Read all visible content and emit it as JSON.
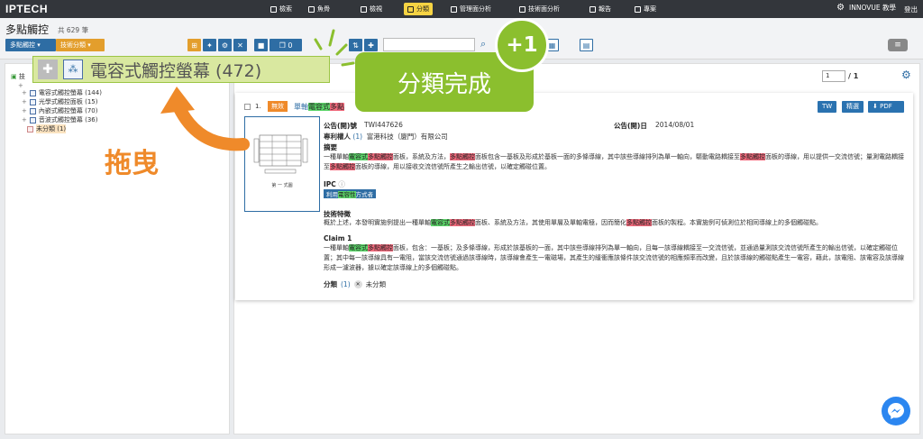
{
  "app": {
    "logo": "IPTECH",
    "logo_icon": "grid-logo-icon"
  },
  "nav": [
    {
      "label": "檢索",
      "icon": "search-icon"
    },
    {
      "label": "魚骨",
      "icon": "fishbone-icon"
    },
    {
      "label": "檢視",
      "icon": "view-icon"
    },
    {
      "label": "分類",
      "icon": "tag-icon",
      "active": true
    },
    {
      "label": "管理面分析",
      "icon": "chart-icon"
    },
    {
      "label": "技術面分析",
      "icon": "chart-icon"
    },
    {
      "label": "報告",
      "icon": "report-icon"
    },
    {
      "label": "專案",
      "icon": "project-icon"
    }
  ],
  "user": {
    "name": "INNOVUE 教學",
    "logout": "登出"
  },
  "header": {
    "title": "多點觸控",
    "count": "共 629 筆",
    "btn1": "多點觸控",
    "btn2": "技術分類",
    "toggle_count": "0"
  },
  "pager": {
    "current": "1",
    "total": "/ 1"
  },
  "tree": {
    "root": "技",
    "items": [
      {
        "label": "電容式觸控螢幕 (144)"
      },
      {
        "label": "光學式觸控面板 (15)"
      },
      {
        "label": "內嵌式觸控螢幕 (70)"
      },
      {
        "label": "音波式觸控螢幕 (36)"
      },
      {
        "label": "未分類 (1)"
      }
    ]
  },
  "card": {
    "index": "1.",
    "badge": "無效",
    "title_pre": "單軸",
    "title_green": "電容式",
    "title_red": "多點",
    "buttons": {
      "tw": "TW",
      "brief": "精選",
      "pdf": "PDF"
    },
    "pub_no_label": "公告(開)號",
    "pub_no": "TWI447626",
    "pub_date_label": "公告(開)日",
    "pub_date": "2014/08/01",
    "assignee_label": "專利權人",
    "assignee_count": "(1)",
    "assignee": "富港科技（廈門）有限公司",
    "abstract_label": "摘要",
    "abs": {
      "p1": "一種單軸",
      "g1": "電容式",
      "r1": "多點觸控",
      "p2": "面板，系統及方法，",
      "r2": "多點觸控",
      "p3": "面板包含一基板及形成於基板一面的多條導線，其中該些導線排列為單一軸向，驅動電路耦接至",
      "r3": "多點觸控",
      "p4": "面板的導線，用以提供一交流信號；量測電路耦接至",
      "r4": "多點觸控",
      "p5": "面板的導線，用以接收交流信號所產生之輸出信號，以確定觸碰位置。"
    },
    "ipc_label": "IPC",
    "ipc_tag_pre": "利用",
    "ipc_tag_hl": "電容性",
    "ipc_tag_post": "方式者",
    "tech_label": "技術特徵",
    "tech": {
      "p1": "概於上述，本發明實施例提出一種單軸",
      "g1": "電容式",
      "r1": "多點觸控",
      "p2": "面板、系統及方法，其使用單層及單軸電極，因而簡化",
      "r2": "多點觸控",
      "p3": "面板的製程。本實施例可偵測位於相同導線上的多個觸碰點。"
    },
    "claim_label": "Claim 1",
    "claim": {
      "p1": "一種單軸",
      "g1": "電容式",
      "r1": "多點觸控",
      "p2": "面板，包含：一基板；及多條導線，形成於該基板的一面，其中該些導線排列為單一軸向，且每一該導線耦接至一交流信號，並通過量測該交流信號所產生的輸出信號，以確定觸碰位置；其中每一該導線具有一電阻，當該交流信號通過該導線時，該導線會產生一電磁場，其產生的緩衝應該條件該交流信號的相應頻率而改變，且於該導線的觸碰點產生一電容，藉此，該電阻、該電容及該導線形成一濾波器，據以確定該導線上的多個觸碰點。"
    },
    "class_label": "分類",
    "class_count": "(1)",
    "class_value": "未分類",
    "figure_caption": "第 一 式圖"
  },
  "overlay": {
    "chip_label": "電容式觸控螢幕 (472)",
    "bubble": "分類完成",
    "plusone": "+1",
    "drag_text": "拖曳"
  }
}
